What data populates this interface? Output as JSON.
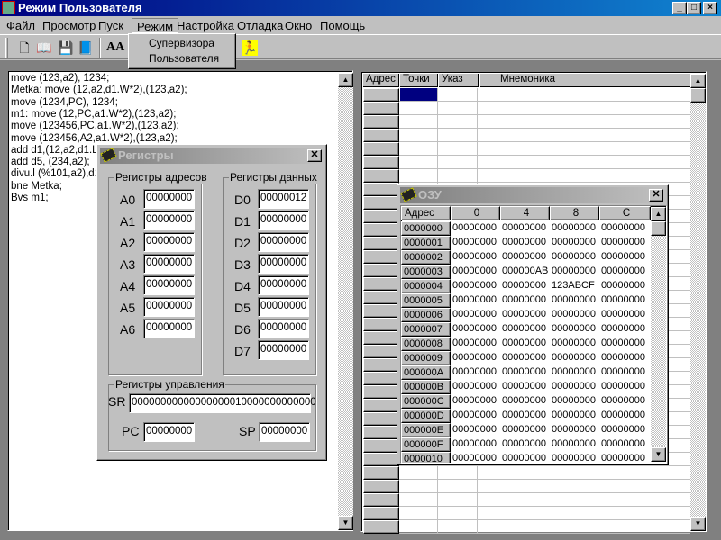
{
  "window": {
    "title": "Режим Пользователя",
    "min": "_",
    "max": "□",
    "close": "×"
  },
  "menu": [
    "Файл",
    "Просмотр",
    "Пуск",
    "Режим",
    "Настройка",
    "Отладка",
    "Окно",
    "Помощь"
  ],
  "dropdown": [
    "Супервизора",
    "Пользователя"
  ],
  "toolbar_icons": [
    "new-file-icon",
    "open-book-icon",
    "save-icon",
    "book-icon",
    "font-icon",
    "help-icon",
    "run-icon"
  ],
  "font_icon_text": "AA",
  "editor": {
    "lines": [
      "move (123,a2), 1234;",
      "Metka: move (12,a2,d1.W*2),(123,a2);",
      "move (1234,PC), 1234;",
      "m1: move (12,PC,a1.W*2),(123,a2);",
      "move (123456,PC,a1.W*2),(123,a2);",
      "move (123456,A2,a1.W*2),(123,a2);",
      "add d1,(12,a2,d1.L*",
      "add d5, (234,a2);",
      "divu.l (%101,a2),d1:",
      "bne Metka;",
      "Bvs m1;"
    ]
  },
  "grid": {
    "headers": [
      "Адрес",
      "Точки",
      "Указ",
      "Мнемоника"
    ],
    "selected_color": "#000080"
  },
  "registers": {
    "title": "Регистры",
    "addr_group": "Регистры адресов",
    "data_group": "Регистры данных",
    "ctrl_group": "Регистры управления",
    "addr": [
      {
        "n": "A0",
        "v": "00000000"
      },
      {
        "n": "A1",
        "v": "00000000"
      },
      {
        "n": "A2",
        "v": "00000000"
      },
      {
        "n": "A3",
        "v": "00000000"
      },
      {
        "n": "A4",
        "v": "00000000"
      },
      {
        "n": "A5",
        "v": "00000000"
      },
      {
        "n": "A6",
        "v": "00000000"
      }
    ],
    "data": [
      {
        "n": "D0",
        "v": "00000012"
      },
      {
        "n": "D1",
        "v": "00000000"
      },
      {
        "n": "D2",
        "v": "00000000"
      },
      {
        "n": "D3",
        "v": "00000000"
      },
      {
        "n": "D4",
        "v": "00000000"
      },
      {
        "n": "D5",
        "v": "00000000"
      },
      {
        "n": "D6",
        "v": "00000000"
      },
      {
        "n": "D7",
        "v": "00000000"
      }
    ],
    "sr_label": "SR",
    "sr": "00000000000000000010000000000000",
    "pc_label": "PC",
    "pc": "00000000",
    "sp_label": "SP",
    "sp": "00000000"
  },
  "ram": {
    "title": "ОЗУ",
    "headers": [
      "Адрес",
      "0",
      "4",
      "8",
      "C"
    ],
    "rows": [
      [
        "0000000",
        "00000000",
        "00000000",
        "00000000",
        "00000000"
      ],
      [
        "0000001",
        "00000000",
        "00000000",
        "00000000",
        "00000000"
      ],
      [
        "0000002",
        "00000000",
        "00000000",
        "00000000",
        "00000000"
      ],
      [
        "0000003",
        "00000000",
        "000000AB",
        "00000000",
        "00000000"
      ],
      [
        "0000004",
        "00000000",
        "00000000",
        "123ABCF",
        "00000000"
      ],
      [
        "0000005",
        "00000000",
        "00000000",
        "00000000",
        "00000000"
      ],
      [
        "0000006",
        "00000000",
        "00000000",
        "00000000",
        "00000000"
      ],
      [
        "0000007",
        "00000000",
        "00000000",
        "00000000",
        "00000000"
      ],
      [
        "0000008",
        "00000000",
        "00000000",
        "00000000",
        "00000000"
      ],
      [
        "0000009",
        "00000000",
        "00000000",
        "00000000",
        "00000000"
      ],
      [
        "000000A",
        "00000000",
        "00000000",
        "00000000",
        "00000000"
      ],
      [
        "000000B",
        "00000000",
        "00000000",
        "00000000",
        "00000000"
      ],
      [
        "000000C",
        "00000000",
        "00000000",
        "00000000",
        "00000000"
      ],
      [
        "000000D",
        "00000000",
        "00000000",
        "00000000",
        "00000000"
      ],
      [
        "000000E",
        "00000000",
        "00000000",
        "00000000",
        "00000000"
      ],
      [
        "000000F",
        "00000000",
        "00000000",
        "00000000",
        "00000000"
      ],
      [
        "0000010",
        "00000000",
        "00000000",
        "00000000",
        "00000000"
      ]
    ]
  }
}
